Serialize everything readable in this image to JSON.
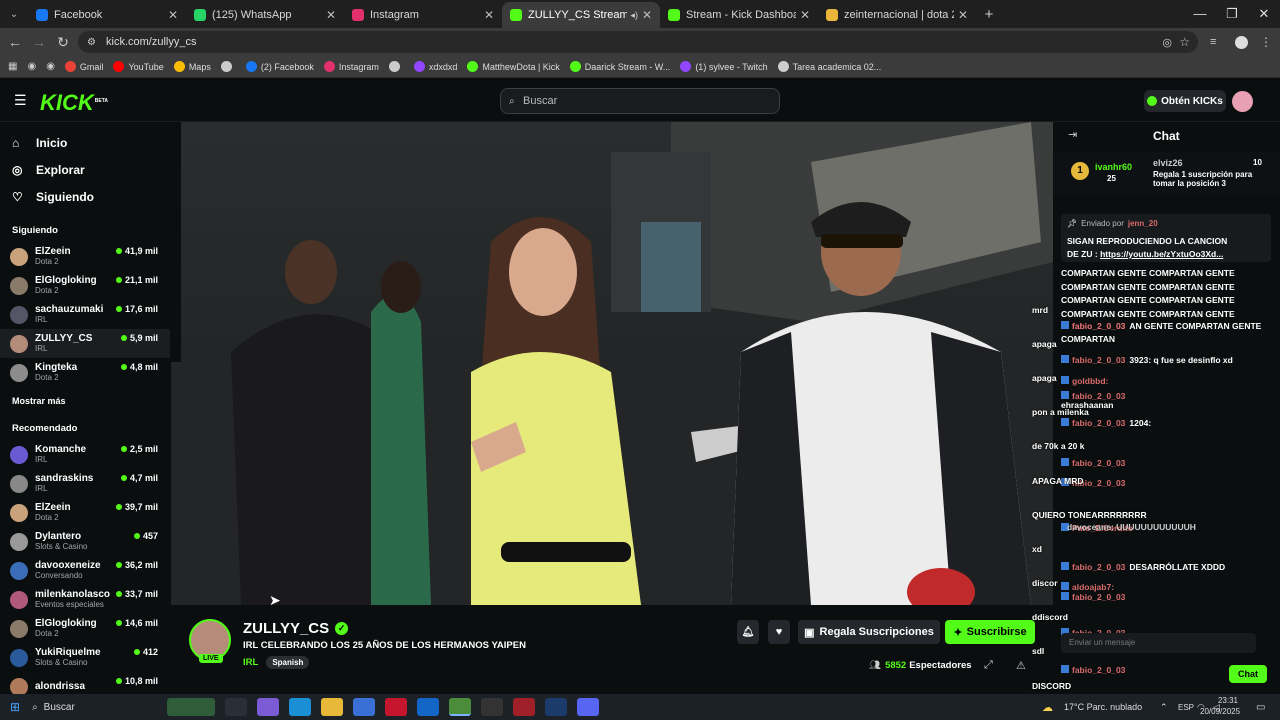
{
  "browser": {
    "tabs": [
      {
        "title": "Facebook",
        "color": "#1877f2"
      },
      {
        "title": "(125) WhatsApp",
        "color": "#25d366"
      },
      {
        "title": "Instagram",
        "color": "#e1306c"
      },
      {
        "title": "ZULLYY_CS Stream - Watch",
        "color": "#53fc18"
      },
      {
        "title": "Stream - Kick Dashboard",
        "color": "#53fc18"
      },
      {
        "title": "zeinternacional | dota 2 Inicio",
        "color": "#e9b53a"
      }
    ],
    "url": "kick.com/zullyy_cs",
    "bookmarks": [
      "Gmail",
      "YouTube",
      "Maps",
      "",
      "(2) Facebook",
      "Instagram",
      "",
      "xdxdxd",
      "MatthewDota | Kick",
      "Daarick Stream - W...",
      "(1) sylvee - Twitch",
      "Tarea academica 02..."
    ]
  },
  "header": {
    "logo": "KICK",
    "beta": "BETA",
    "search_placeholder": "Buscar",
    "kicks_label": "Obtén KICKs"
  },
  "sidebar": {
    "nav": [
      {
        "label": "Inicio",
        "icon": "home-icon"
      },
      {
        "label": "Explorar",
        "icon": "compass-icon"
      },
      {
        "label": "Siguiendo",
        "icon": "heart-icon"
      }
    ],
    "following_title": "Siguiendo",
    "following": [
      {
        "name": "ElZeein",
        "category": "Dota 2",
        "viewers": "41,9 mil",
        "color": "#c9a27c"
      },
      {
        "name": "ElGlogloking",
        "category": "Dota 2",
        "viewers": "21,1 mil",
        "color": "#8a7a6a"
      },
      {
        "name": "sachauzumaki",
        "category": "IRL",
        "viewers": "17,6 mil",
        "color": "#556"
      },
      {
        "name": "ZULLYY_CS",
        "category": "IRL",
        "viewers": "5,9 mil",
        "color": "#b58b7a"
      },
      {
        "name": "Kingteka",
        "category": "Dota 2",
        "viewers": "4,8 mil",
        "color": "#8c8c8c"
      }
    ],
    "show_more": "Mostrar más",
    "recommended_title": "Recomendado",
    "recommended": [
      {
        "name": "Komanche",
        "category": "IRL",
        "viewers": "2,5 mil",
        "color": "#6b5bd3"
      },
      {
        "name": "sandraskins",
        "category": "IRL",
        "viewers": "4,7 mil",
        "color": "#888"
      },
      {
        "name": "ElZeein",
        "category": "Dota 2",
        "viewers": "39,7 mil",
        "color": "#c9a27c"
      },
      {
        "name": "Dylantero",
        "category": "Slots & Casino",
        "viewers": "457",
        "color": "#999"
      },
      {
        "name": "davooxeneize",
        "category": "Conversando",
        "viewers": "36,2 mil",
        "color": "#3a6db5"
      },
      {
        "name": "milenkanolasco",
        "category": "Eventos especiales",
        "viewers": "33,7 mil",
        "color": "#b05a7a"
      },
      {
        "name": "ElGlogloking",
        "category": "Dota 2",
        "viewers": "14,6 mil",
        "color": "#8a7a6a"
      },
      {
        "name": "YukiRiquelme",
        "category": "Slots & Casino",
        "viewers": "412",
        "color": "#2a5a9a"
      },
      {
        "name": "alondrissa",
        "category": "",
        "viewers": "10,8 mil",
        "color": "#b07a5a"
      }
    ]
  },
  "stream": {
    "channel": "ZULLYY_CS",
    "title": "IRL CELEBRANDO LOS 25 AÑOS DE  LOS HERMANOS YAIPEN",
    "category": "IRL",
    "tag": "Spanish",
    "live": "LIVE",
    "gift_label": "Regala Suscripciones",
    "subscribe_label": "Suscribirse",
    "viewers": "5852",
    "viewers_label": "Espectadores"
  },
  "chat": {
    "title": "Chat",
    "top1": {
      "name": "ivanhr60",
      "count": "25"
    },
    "top2": {
      "name": "elviz26",
      "count": "10"
    },
    "gift_prompt": "Regala 1 suscripción para tomar la posición 3",
    "pinned_by_label": "Enviado por",
    "pinned_by": "jenn_20",
    "pinned_text1": "SIGAN REPRODUCIENDO LA CANCION",
    "pinned_text2": "DE ZU : ",
    "pinned_link": "https://youtu.be/zYxtuOo3Xd...",
    "messages": [
      {
        "user": "",
        "text": "COMPARTAN GENTE COMPARTAN GENTE"
      },
      {
        "user": "",
        "text": "COMPARTAN GENTE COMPARTAN GENTE"
      },
      {
        "user": "",
        "text": "COMPARTAN GENTE COMPARTAN GENTE"
      },
      {
        "user": "fabio_2_0_03",
        "text": ""
      },
      {
        "user": "",
        "text": "COMPARTAN GENTE COMPARTAN GENTE"
      },
      {
        "user": "fabio_2_0_03",
        "text": "AN GENTE COMPARTAN GENTE"
      },
      {
        "user": "",
        "text": "COMPARTAN"
      },
      {
        "user": "fabio_2_0_03",
        "text": "3923: q fue se desinflo xd"
      },
      {
        "user": "goldbbd:",
        "text": ""
      },
      {
        "user": "fabio_2_0_03",
        "text": ""
      },
      {
        "user": "",
        "text": "ehrashaanan"
      },
      {
        "user": "fabio_2_0_03",
        "text": "1204:"
      },
      {
        "user": "fabio_2_0_03",
        "text": ""
      },
      {
        "user": "fabio_2_0_03",
        "text": ""
      },
      {
        "user": "Pato_ElCerdito",
        "text": ""
      },
      {
        "user": "fabio_2_0_03",
        "text": "DESARRÓLLATE XDDD"
      },
      {
        "user": "aldoajab7:",
        "text": ""
      },
      {
        "user": "fabio_2_0_03",
        "text": ""
      },
      {
        "user": "fabio_2_0_03",
        "text": ""
      },
      {
        "user": "fabio_2_0_03",
        "text": ""
      }
    ],
    "overlay_lines": [
      "mrd",
      "apaga",
      "apaga",
      "pon a milenka",
      "de 70k a 20 k",
      "APAGA MRD",
      "QUIERO TONEARRRRRRRR",
      "xd",
      "discor",
      "ddiscord",
      "sdl",
      "DISCORD"
    ],
    "extra_line": "davoceane: UUUUUUUUUUUUH",
    "input_placeholder": "Enviar un mensaje",
    "send_label": "Chat"
  },
  "taskbar": {
    "search": "Buscar",
    "weather": "17°C  Parc. nublado",
    "lang": "ESP",
    "time": "23:31",
    "date": "20/09/2025"
  },
  "colors": {
    "accent": "#53fc18",
    "bg": "#0b0e0f",
    "sidebar_sel": "#1b1e21"
  }
}
